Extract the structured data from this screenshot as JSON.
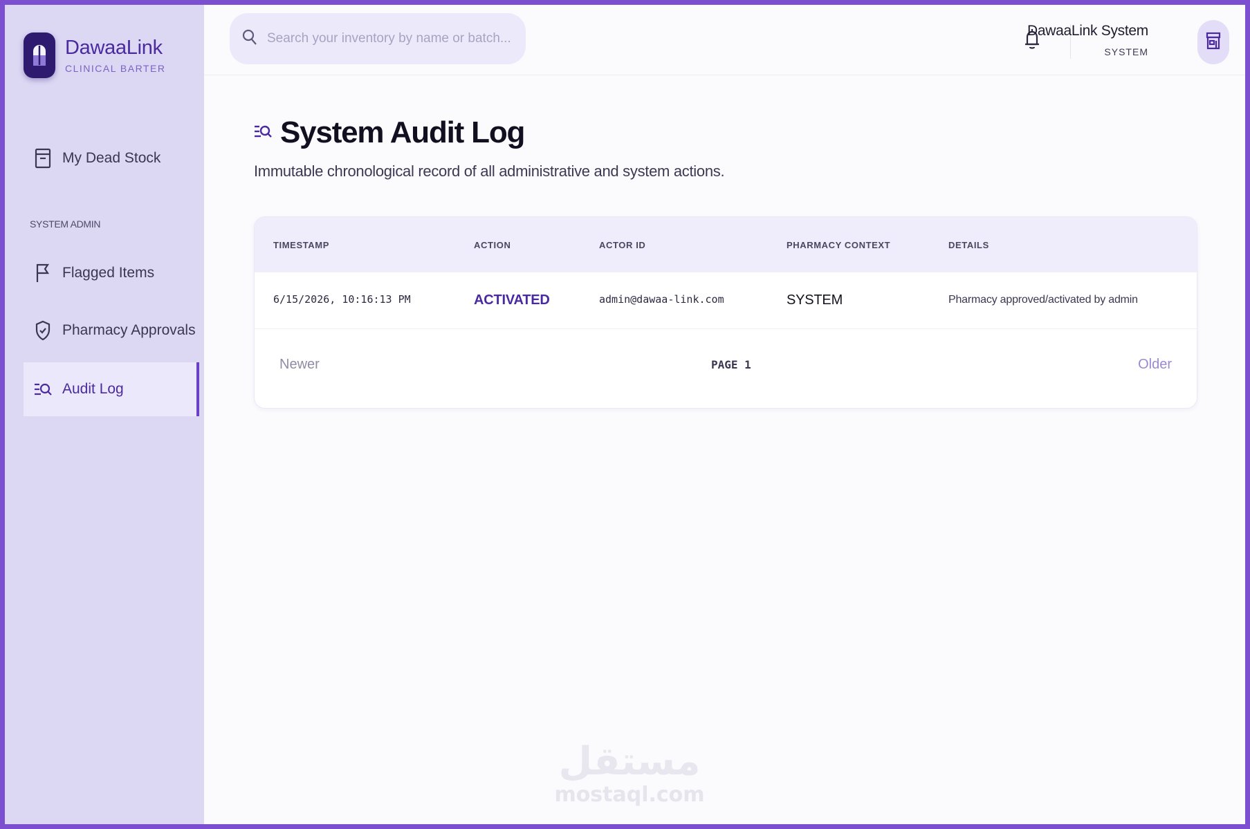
{
  "brand": {
    "name": "DawaaLink",
    "subtitle": "CLINICAL BARTER",
    "logo_icon": "pill-capsule-icon"
  },
  "sidebar": {
    "items": [
      {
        "label": "My Dead Stock",
        "icon": "archive-box-icon"
      },
      {
        "label": "Flagged Items",
        "icon": "flag-icon"
      },
      {
        "label": "Pharmacy Approvals",
        "icon": "shield-check-icon"
      },
      {
        "label": "Audit Log",
        "icon": "list-search-icon",
        "active": true
      }
    ],
    "section_label": "SYSTEM ADMIN"
  },
  "topbar": {
    "search_placeholder": "Search your inventory by name or batch...",
    "user_name": "DawaaLink System",
    "user_role": "SYSTEM",
    "notification_icon": "bell-icon",
    "avatar_icon": "store-icon"
  },
  "page": {
    "title": "System Audit Log",
    "description": "Immutable chronological record of all administrative and system actions."
  },
  "table": {
    "columns": [
      "TIMESTAMP",
      "ACTION",
      "ACTOR ID",
      "PHARMACY CONTEXT",
      "DETAILS"
    ],
    "rows": [
      {
        "timestamp": "6/15/2026, 10:16:13 PM",
        "action": "ACTIVATED",
        "actor_id": "admin@dawaa-link.com",
        "pharmacy_context": "SYSTEM",
        "details": "Pharmacy approved/activated by admin"
      }
    ]
  },
  "pagination": {
    "newer_label": "Newer",
    "page_label": "PAGE 1",
    "older_label": "Older"
  },
  "watermark": {
    "arabic": "مستقل",
    "latin": "mostaql.com"
  },
  "colors": {
    "accent": "#4a2a9e",
    "sidebar_bg": "#dcd8f4",
    "frame": "#7b4fcf"
  }
}
